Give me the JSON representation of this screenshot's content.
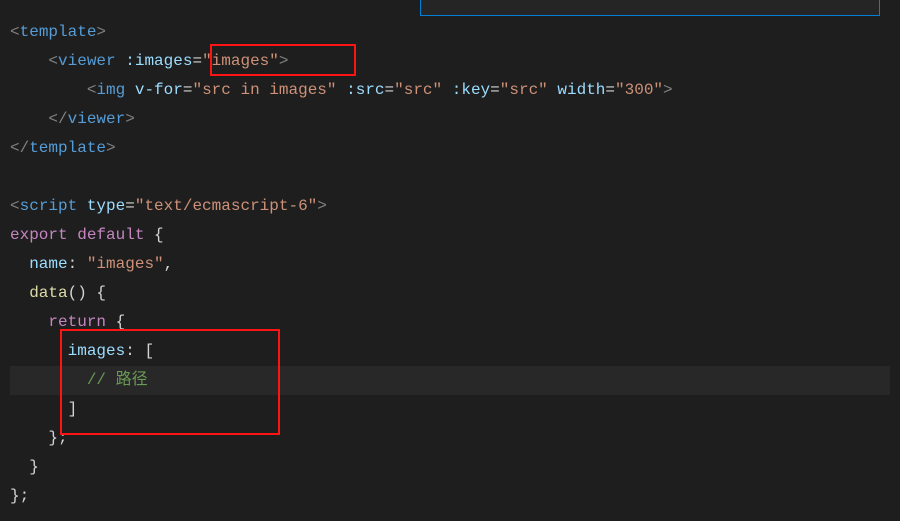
{
  "code": {
    "l1": {
      "open": "<",
      "tag": "template",
      "close": ">"
    },
    "l2": {
      "open": "<",
      "tag": "viewer",
      "sp": " ",
      "attr": ":images",
      "eq": "=",
      "val": "\"images\"",
      "close": ">"
    },
    "l3": {
      "open": "<",
      "tag": "img",
      "sp": " ",
      "attr1": "v-for",
      "eq1": "=",
      "val1": "\"src in images\"",
      "sp2": " ",
      "attr2": ":src",
      "eq2": "=",
      "val2": "\"src\"",
      "sp3": " ",
      "attr3": ":key",
      "eq3": "=",
      "val3": "\"src\"",
      "sp4": " ",
      "attr4": "width",
      "eq4": "=",
      "val4": "\"300\"",
      "close": ">"
    },
    "l4": {
      "open": "</",
      "tag": "viewer",
      "close": ">"
    },
    "l5": {
      "open": "</",
      "tag": "template",
      "close": ">"
    },
    "l6": "",
    "l7": {
      "open": "<",
      "tag": "script",
      "sp": " ",
      "attr": "type",
      "eq": "=",
      "val": "\"text/ecmascript-6\"",
      "close": ">"
    },
    "l8": {
      "kw1": "export",
      "sp": " ",
      "kw2": "default",
      "sp2": " ",
      "brace": "{"
    },
    "l9": {
      "prop": "name",
      "colon": ":",
      "sp": " ",
      "val": "\"images\"",
      "comma": ","
    },
    "l10": {
      "func": "data",
      "paren": "()",
      "sp": " ",
      "brace": "{"
    },
    "l11": {
      "kw": "return",
      "sp": " ",
      "brace": "{"
    },
    "l12": {
      "prop": "images",
      "colon": ":",
      "sp": " ",
      "bracket": "["
    },
    "l13": {
      "comment": "// 路径"
    },
    "l14": {
      "bracket": "]"
    },
    "l15": {
      "brace": "}",
      "semi": ";"
    },
    "l16": {
      "brace": "}"
    },
    "l17": {
      "brace": "}",
      "semi": ";"
    }
  }
}
